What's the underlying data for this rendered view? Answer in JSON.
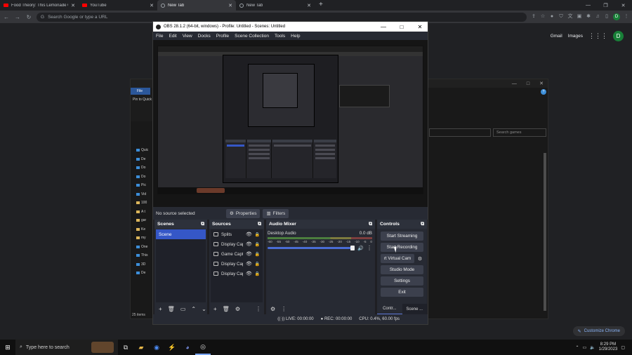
{
  "browser": {
    "tabs": [
      {
        "label": "Food Theory: This Lemonade Co",
        "icon": "youtube-icon",
        "active": false
      },
      {
        "label": "YouTube",
        "icon": "youtube-icon",
        "active": false
      },
      {
        "label": "New Tab",
        "icon": "globe-icon",
        "active": true
      },
      {
        "label": "New Tab",
        "icon": "globe-icon",
        "active": false
      }
    ],
    "omnibox_placeholder": "Search Google or type a URL",
    "profile_initial": "D"
  },
  "google": {
    "gmail": "Gmail",
    "images": "Images",
    "avatar_initial": "D",
    "customize_label": "Customize Chrome"
  },
  "explorer": {
    "file_tab": "File",
    "pin_label": "Pin to Quick access",
    "search_placeholder": "Search games",
    "item_count": "25 items",
    "tree": [
      "Quic",
      "De",
      "Do",
      "Do",
      "Pic",
      "Vid",
      "100",
      "A t",
      "gar",
      "Ke",
      "my",
      "One",
      "This",
      "3D",
      "De"
    ]
  },
  "obs": {
    "title": "OBS 28.1.2 (64-bit, windows) - Profile: Untitled - Scenes: Untitled",
    "menu": [
      "File",
      "Edit",
      "View",
      "Docks",
      "Profile",
      "Scene Collection",
      "Tools",
      "Help"
    ],
    "no_source": "No source selected",
    "properties_label": "Properties",
    "filters_label": "Filters",
    "scenes": {
      "title": "Scenes",
      "items": [
        "Scene"
      ]
    },
    "sources": {
      "title": "Sources",
      "items": [
        "Splits",
        "Display Cap",
        "Game Capt",
        "Display Cap",
        "Display Cap"
      ]
    },
    "mixer": {
      "title": "Audio Mixer",
      "channel": "Desktop Audio",
      "level": "0.0 dB",
      "ticks": [
        "-60",
        "-55",
        "-50",
        "-45",
        "-40",
        "-35",
        "-30",
        "-25",
        "-20",
        "-15",
        "-10",
        "-5",
        "0"
      ],
      "volume_fraction": 1.0
    },
    "controls": {
      "title": "Controls",
      "start_streaming": "Start Streaming",
      "start_recording": "Start Recording",
      "virtual_cam": "rt Virtual Cam",
      "studio_mode": "Studio Mode",
      "settings": "Settings",
      "exit": "Exit"
    },
    "dock_tabs": [
      "Contr...",
      "Scene ..."
    ],
    "status": {
      "live": "LIVE: 00:00:00",
      "rec": "REC: 00:00:00",
      "cpu": "CPU: 0.4%, 60.00 fps"
    }
  },
  "taskbar": {
    "search_placeholder": "Type here to search",
    "time": "8:29 PM",
    "date": "1/29/2023"
  }
}
